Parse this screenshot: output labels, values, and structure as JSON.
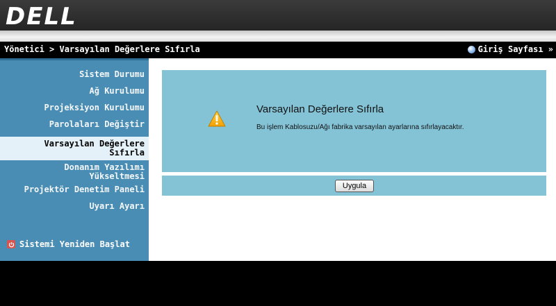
{
  "header": {
    "logo_text": "DELL",
    "brand_color": "#ffffff"
  },
  "titlebar": {
    "breadcrumb": "Yönetici > Varsayılan Değerlere Sıfırla",
    "home_link": "Giriş Sayfası »",
    "home_icon": "globe-icon"
  },
  "sidebar": {
    "items": [
      {
        "label": "Sistem Durumu"
      },
      {
        "label": "Ağ Kurulumu"
      },
      {
        "label": "Projeksiyon Kurulumu"
      },
      {
        "label": "Parolaları Değiştir"
      },
      {
        "label_line1": "Varsayılan Değerlere",
        "label_line2": "Sıfırla",
        "active": true
      },
      {
        "label_line1": "Donanım Yazılımı",
        "label_line2": "Yükseltmesi"
      },
      {
        "label": "Projektör Denetim Paneli"
      },
      {
        "label": "Uyarı Ayarı"
      }
    ],
    "restart_label": "Sistemi Yeniden Başlat",
    "restart_icon": "power-icon",
    "bg_color": "#4a8db4",
    "active_bg_color": "#e4f1f8"
  },
  "main": {
    "icon": "warning-icon",
    "title": "Varsayılan Değerlere Sıfırla",
    "description": "Bu işlem Kablosuzu/Ağı fabrika varsayılan ayarlarına sıfırlayacaktır.",
    "apply_label": "Uygula",
    "panel_color": "#84c3d6"
  }
}
